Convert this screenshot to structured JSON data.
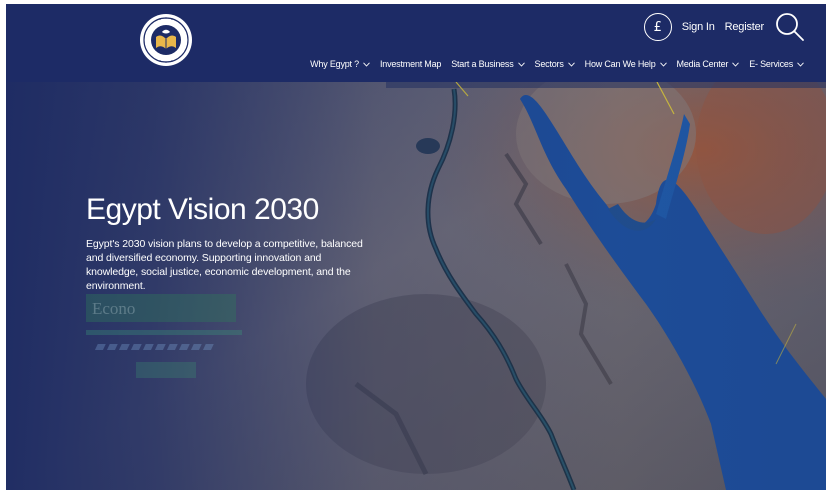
{
  "header": {
    "logo_icon": "egypt-investment-authority-seal",
    "currency_symbol": "£",
    "sign_in": "Sign In",
    "register": "Register",
    "search_icon": "search-icon"
  },
  "nav": {
    "items": [
      {
        "label": "Why Egypt ?",
        "dropdown": true
      },
      {
        "label": "Investment Map",
        "dropdown": false
      },
      {
        "label": "Start a Business",
        "dropdown": true
      },
      {
        "label": "Sectors",
        "dropdown": true
      },
      {
        "label": "How Can We Help",
        "dropdown": true
      },
      {
        "label": "Media Center",
        "dropdown": true
      },
      {
        "label": "E- Services",
        "dropdown": true
      }
    ]
  },
  "hero": {
    "title": "Egypt Vision 2030",
    "description": "Egypt's 2030 vision plans to develop a competitive, balanced and diversified economy. Supporting innovation and knowledge, social justice, economic development, and the environment.",
    "ghost_label": "Econo"
  },
  "colors": {
    "navy": "#1d2b66",
    "sea": "#1d4f9c",
    "land": "#6f6a72",
    "desert": "#a0522d"
  }
}
